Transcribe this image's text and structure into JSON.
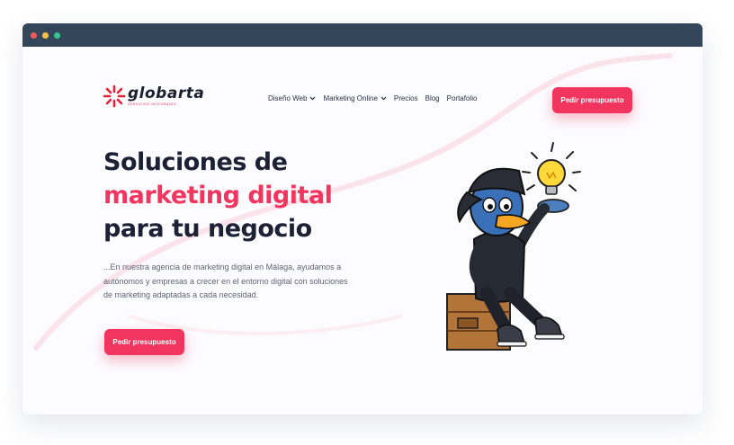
{
  "colors": {
    "accent": "#f1355e",
    "titlebar": "#34465a",
    "heading": "#1d2135",
    "dot_red": "#ee5a5a",
    "dot_yellow": "#f4c04a",
    "dot_green": "#35c48f"
  },
  "brand": {
    "name": "globarta",
    "tagline": "SERVICIOS INTEGRALES",
    "logo_icon": "starburst-logo-icon"
  },
  "nav": {
    "items": [
      {
        "label": "Diseño Web",
        "has_dropdown": true
      },
      {
        "label": "Marketing Online",
        "has_dropdown": true
      },
      {
        "label": "Precios",
        "has_dropdown": false
      },
      {
        "label": "Blog",
        "has_dropdown": false
      },
      {
        "label": "Portafolio",
        "has_dropdown": false
      }
    ]
  },
  "header": {
    "cta_label": "Pedir presupuesto"
  },
  "hero": {
    "title_line1": "Soluciones de",
    "title_line2": "marketing digital",
    "title_line3": "para tu negocio",
    "description": "...En nuestra agencia de marketing digital en Málaga, ayudamos a autónomos y empresas a crecer en el entorno digital con soluciones de marketing adaptadas a cada necesidad.",
    "cta_label": "Pedir presupuesto",
    "illustration": "duck-mascot-with-lightbulb"
  }
}
